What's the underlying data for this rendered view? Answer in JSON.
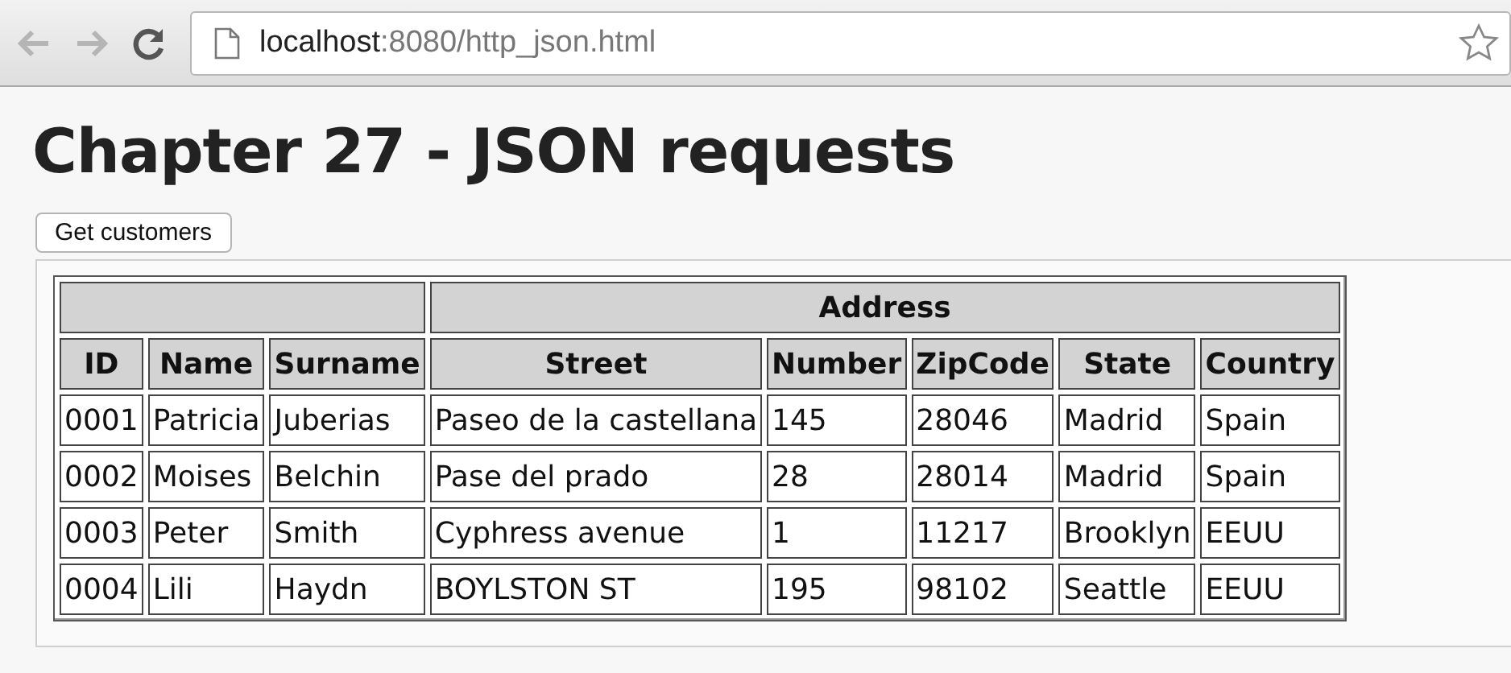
{
  "browser": {
    "address": {
      "host": "localhost",
      "path": ":8080/http_json.html"
    }
  },
  "heading": "Chapter 27 - JSON requests",
  "button": "Get customers",
  "table": {
    "group_header": "Address",
    "columns": [
      "ID",
      "Name",
      "Surname",
      "Street",
      "Number",
      "ZipCode",
      "State",
      "Country"
    ],
    "rows": [
      [
        "0001",
        "Patricia",
        "Juberias",
        "Paseo de la castellana",
        "145",
        "28046",
        "Madrid",
        "Spain"
      ],
      [
        "0002",
        "Moises",
        "Belchin",
        "Pase del prado",
        "28",
        "28014",
        "Madrid",
        "Spain"
      ],
      [
        "0003",
        "Peter",
        "Smith",
        "Cyphress avenue",
        "1",
        "11217",
        "Brooklyn",
        "EEUU"
      ],
      [
        "0004",
        "Lili",
        "Haydn",
        "BOYLSTON ST",
        "195",
        "98102",
        "Seattle",
        "EEUU"
      ]
    ]
  }
}
